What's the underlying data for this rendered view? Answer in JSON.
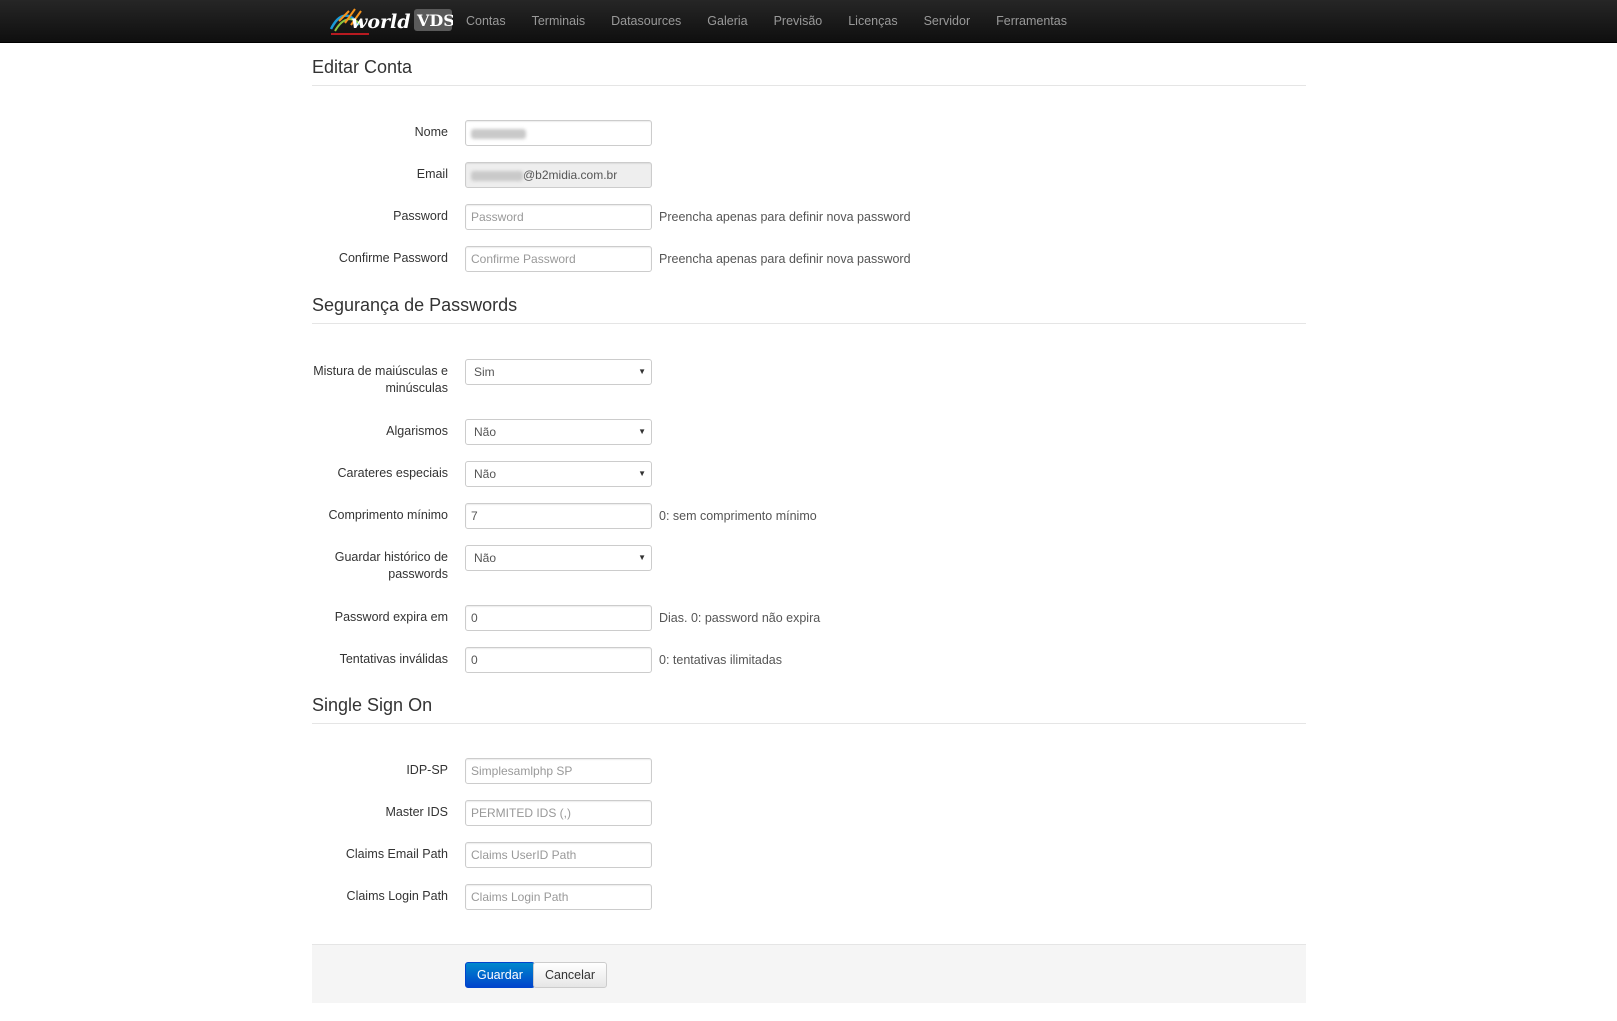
{
  "brand": {
    "logo_text_world": "world",
    "logo_text_vds": "VDS"
  },
  "nav": [
    "Contas",
    "Terminais",
    "Datasources",
    "Galeria",
    "Previsão",
    "Licenças",
    "Servidor",
    "Ferramentas"
  ],
  "sections": {
    "account": "Editar Conta",
    "security": "Segurança de Passwords",
    "sso": "Single Sign On"
  },
  "account": {
    "nome_label": "Nome",
    "email_label": "Email",
    "email_domain": "@b2midia.com.br",
    "password_label": "Password",
    "password_placeholder": "Password",
    "password_help": "Preencha apenas para definir nova password",
    "confirm_label": "Confirme Password",
    "confirm_placeholder": "Confirme Password",
    "confirm_help": "Preencha apenas para definir nova password"
  },
  "security": {
    "mixcase_label": "Mistura de maiúsculas e minúsculas",
    "mixcase_value": "Sim",
    "digits_label": "Algarismos",
    "digits_value": "Não",
    "special_label": "Carateres especiais",
    "special_value": "Não",
    "minlen_label": "Comprimento mínimo",
    "minlen_value": "7",
    "minlen_help": "0: sem comprimento mínimo",
    "history_label": "Guardar histórico de passwords",
    "history_value": "Não",
    "expire_label": "Password expira em",
    "expire_value": "0",
    "expire_help": "Dias. 0: password não expira",
    "attempts_label": "Tentativas inválidas",
    "attempts_value": "0",
    "attempts_help": "0: tentativas ilimitadas"
  },
  "sso": {
    "idp_label": "IDP-SP",
    "idp_placeholder": "Simplesamlphp SP",
    "master_label": "Master IDS",
    "master_placeholder": "PERMITED IDS (,)",
    "claims_email_label": "Claims Email Path",
    "claims_email_placeholder": "Claims UserID Path",
    "claims_login_label": "Claims Login Path",
    "claims_login_placeholder": "Claims Login Path"
  },
  "actions": {
    "save": "Guardar",
    "cancel": "Cancelar"
  },
  "colors": {
    "primary": "#0055cc",
    "navbar": "#1b1b1b"
  }
}
